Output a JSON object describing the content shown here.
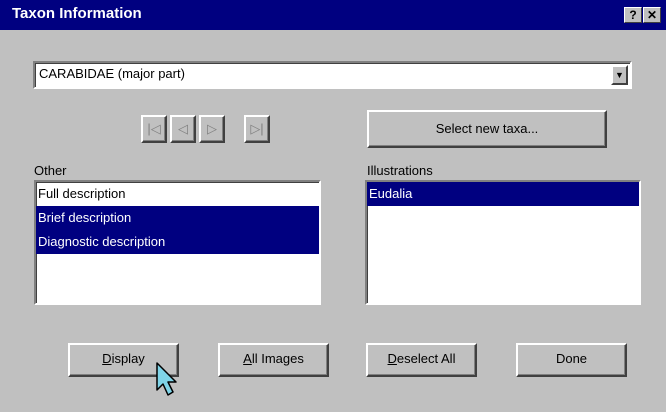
{
  "window": {
    "title": "Taxon Information",
    "help_button": "?",
    "close_button": "✕"
  },
  "taxon_select": {
    "value": "CARABIDAE (major part)"
  },
  "nav_buttons": {
    "first": "|◁",
    "previous": "◁",
    "next": "▷",
    "last": "▷|"
  },
  "select_new_taxa_label": "Select new taxa...",
  "other_list": {
    "label": "Other",
    "items": [
      {
        "label": "Full description",
        "selected": false
      },
      {
        "label": "Brief description",
        "selected": true
      },
      {
        "label": "Diagnostic description",
        "selected": true
      }
    ]
  },
  "illustrations_list": {
    "label": "Illustrations",
    "items": [
      {
        "label": "Eudalia",
        "selected": true
      }
    ]
  },
  "buttons": {
    "display_accel": "D",
    "display_rest": "isplay",
    "all_images_accel": "A",
    "all_images_rest": "ll Images",
    "deselect_all_accel": "D",
    "deselect_all_rest": "eselect All",
    "done": "Done"
  },
  "colors": {
    "title_bar": "#000080",
    "selection": "#000080",
    "face": "#c0c0c0"
  }
}
